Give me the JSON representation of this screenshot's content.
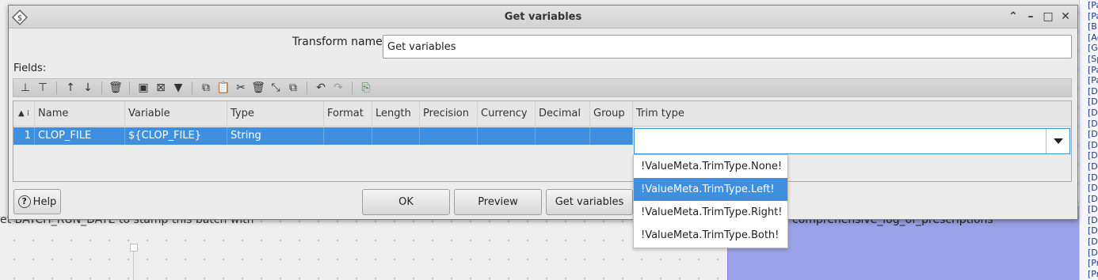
{
  "background": {
    "note_left": "et BATCH_RUN_DATE to stamp this batch with",
    "note_right": "comprehensive_log_of_prescriptions",
    "right_panel_items": [
      "[Pa",
      "[Pa",
      "[Bi",
      "[Ac",
      "[G",
      "[Sp",
      "[Pa",
      "[Pa",
      "[D",
      "[D",
      "[D",
      "[D",
      "[D",
      "[D",
      "[D",
      "[D",
      "[D",
      "[D",
      "[D",
      "[D",
      "[D",
      "[D",
      "[D",
      "[D",
      "[Pr",
      "[Pr",
      "[F"
    ]
  },
  "dialog": {
    "title": "Get variables",
    "transform_name_label": "Transform name",
    "transform_name_value": "Get variables",
    "fields_label": "Fields:",
    "columns": [
      "Name",
      "Variable",
      "Type",
      "Format",
      "Length",
      "Precision",
      "Currency",
      "Decimal",
      "Group",
      "Trim type"
    ],
    "rows": [
      {
        "num": "1",
        "name": "CLOP_FILE",
        "variable": "${CLOP_FILE}",
        "type": "String",
        "format": "",
        "length": "",
        "precision": "",
        "currency": "",
        "decimal": "",
        "group": ""
      }
    ],
    "trim_type_value": "",
    "trim_options": [
      "!ValueMeta.TrimType.None!",
      "!ValueMeta.TrimType.Left!",
      "!ValueMeta.TrimType.Right!",
      "!ValueMeta.TrimType.Both!"
    ],
    "trim_selected_index": 1,
    "buttons": {
      "help": "Help",
      "ok": "OK",
      "preview": "Preview",
      "get_variables": "Get variables"
    }
  }
}
